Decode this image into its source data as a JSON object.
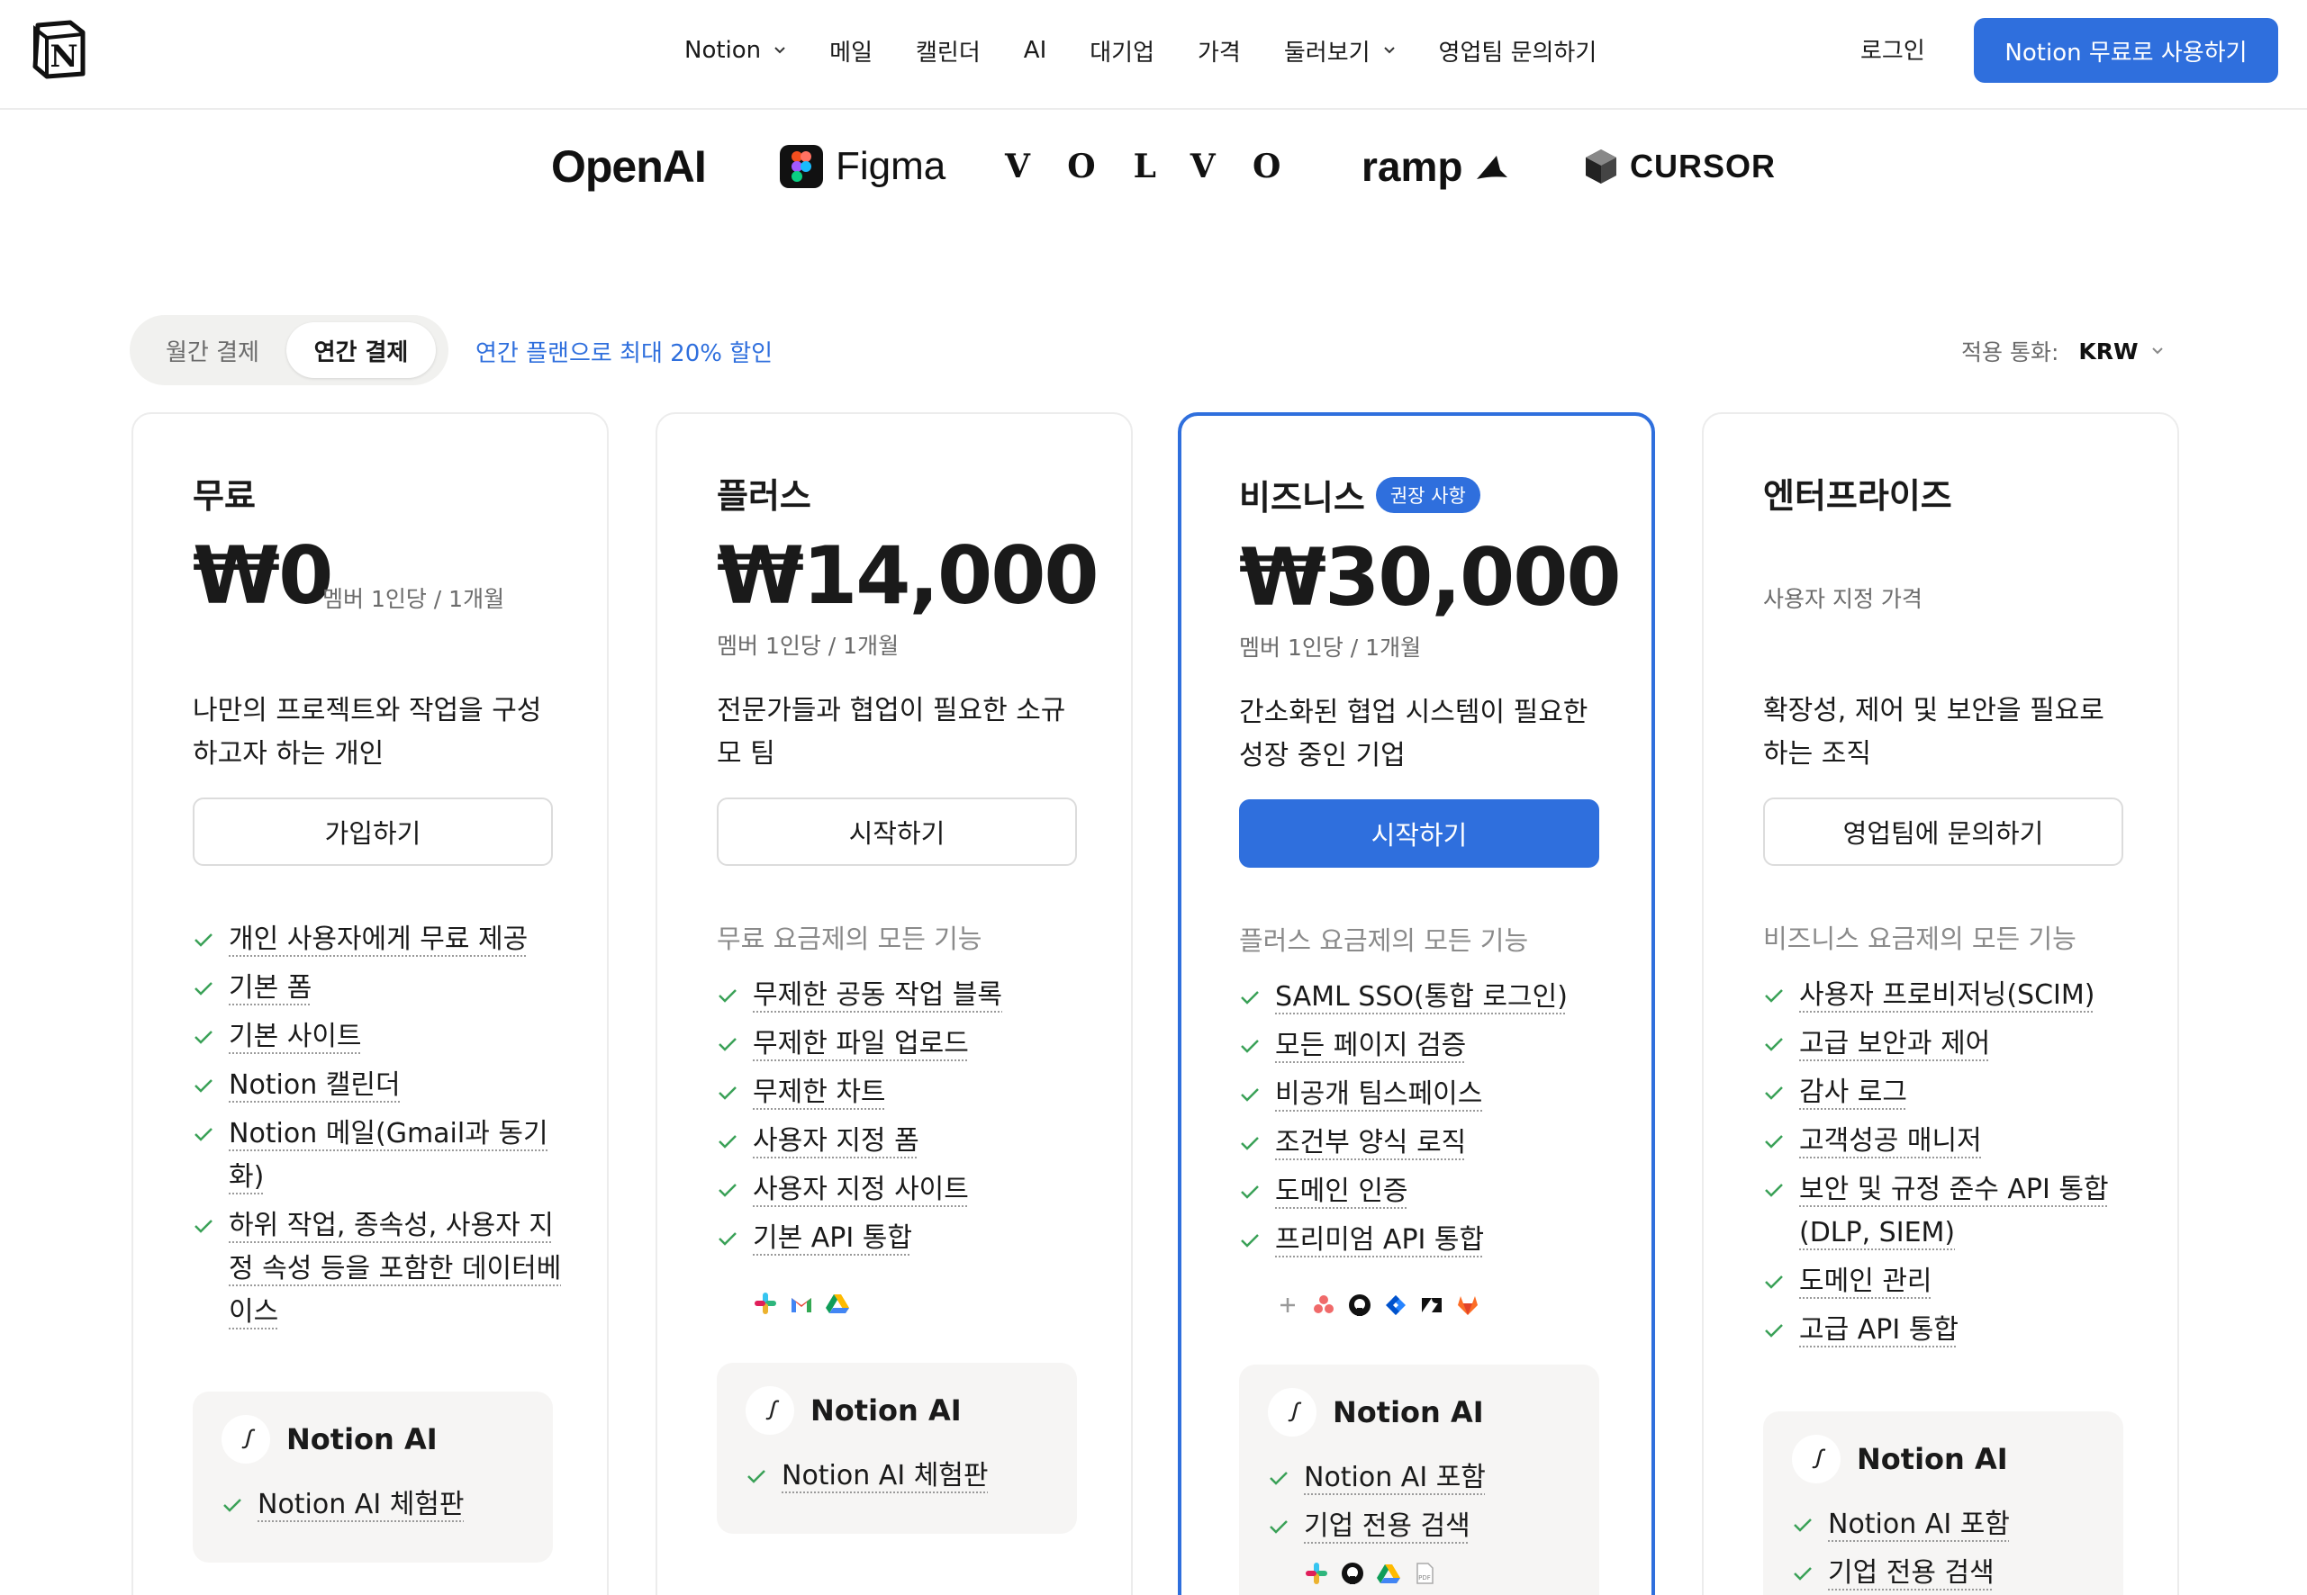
{
  "nav": {
    "items": [
      {
        "label": "Notion",
        "dropdown": true
      },
      {
        "label": "메일",
        "dropdown": false
      },
      {
        "label": "캘린더",
        "dropdown": false
      },
      {
        "label": "AI",
        "dropdown": false
      },
      {
        "label": "대기업",
        "dropdown": false
      },
      {
        "label": "가격",
        "dropdown": false
      },
      {
        "label": "둘러보기",
        "dropdown": true
      },
      {
        "label": "영업팀 문의하기",
        "dropdown": false
      }
    ],
    "login": "로그인",
    "cta": "Notion 무료로 사용하기"
  },
  "brands": {
    "openai": "OpenAI",
    "figma": "Figma",
    "volvo": "VOLVO",
    "ramp": "ramp",
    "cursor": "CURSOR"
  },
  "billing": {
    "monthly": "월간 결제",
    "annual": "연간 결제",
    "selected": "annual",
    "discount": "연간 플랜으로 최대 20% 할인",
    "currency_label": "적용 통화:",
    "currency_value": "KRW"
  },
  "plans": [
    {
      "name": "무료",
      "price": "₩0",
      "per": "멤버 1인당 / 1개월",
      "description": "나만의 프로젝트와 작업을 구성하고자 하는 개인",
      "button": "가입하기",
      "subhead": "",
      "features": [
        "개인 사용자에게 무료 제공",
        "기본 폼",
        "기본 사이트",
        "Notion 캘린더",
        "Notion 메일(Gmail과 동기화)",
        "하위 작업, 종속성, 사용자 지정 속성 등을 포함한 데이터베이스"
      ],
      "ai": {
        "title": "Notion AI",
        "features": [
          "Notion AI 체험판"
        ]
      }
    },
    {
      "name": "플러스",
      "price": "₩14,000",
      "per": "멤버 1인당 / 1개월",
      "description": "전문가들과 협업이 필요한 소규모 팀",
      "button": "시작하기",
      "subhead": "무료 요금제의 모든 기능",
      "features": [
        "무제한 공동 작업 블록",
        "무제한 파일 업로드",
        "무제한 차트",
        "사용자 지정 폼",
        "사용자 지정 사이트",
        "기본 API 통합"
      ],
      "integrations": [
        "slack-icon",
        "gmail-icon",
        "google-drive-icon"
      ],
      "ai": {
        "title": "Notion AI",
        "features": [
          "Notion AI 체험판"
        ]
      }
    },
    {
      "name": "비즈니스",
      "badge": "권장 사항",
      "price": "₩30,000",
      "per": "멤버 1인당 / 1개월",
      "description": "간소화된 협업 시스템이 필요한 성장 중인 기업",
      "button": "시작하기",
      "subhead": "플러스 요금제의 모든 기능",
      "features": [
        "SAML SSO(통합 로그인)",
        "모든 페이지 검증",
        "비공개 팀스페이스",
        "조건부 양식 로직",
        "도메인 인증",
        "프리미엄 API 통합"
      ],
      "integrations": [
        "plus-icon",
        "asana-icon",
        "github-icon",
        "jira-icon",
        "zendesk-icon",
        "gitlab-icon"
      ],
      "ai": {
        "title": "Notion AI",
        "features": [
          "Notion AI 포함",
          "기업 전용 검색"
        ],
        "integrations": [
          "slack-icon",
          "github-icon",
          "google-drive-icon",
          "pdf-icon"
        ]
      }
    },
    {
      "name": "엔터프라이즈",
      "price": "",
      "per": "사용자 지정 가격",
      "description": "확장성, 제어 및 보안을 필요로 하는 조직",
      "button": "영업팀에 문의하기",
      "subhead": "비즈니스 요금제의 모든 기능",
      "features": [
        "사용자 프로비저닝(SCIM)",
        "고급 보안과 제어",
        "감사 로그",
        "고객성공 매니저",
        "보안 및 규정 준수 API 통합(DLP, SIEM)",
        "도메인 관리",
        "고급 API 통합"
      ],
      "ai": {
        "title": "Notion AI",
        "features": [
          "Notion AI 포함",
          "기업 전용 검색"
        ]
      }
    }
  ],
  "colors": {
    "accent": "#2f6fdd",
    "check": "#3aa157",
    "muted": "#6b6b6b"
  }
}
